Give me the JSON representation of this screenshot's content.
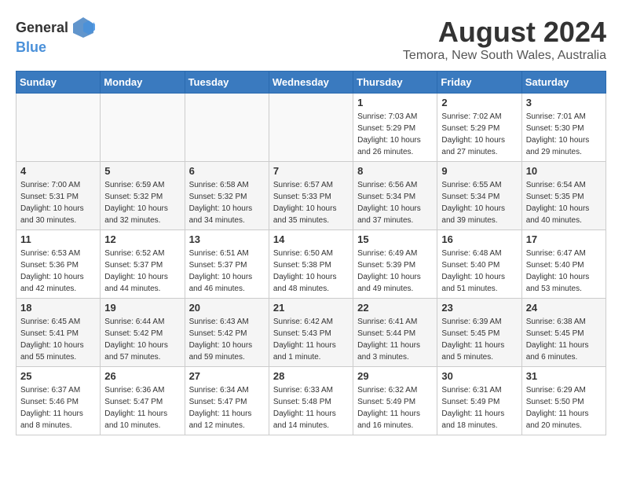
{
  "header": {
    "logo_general": "General",
    "logo_blue": "Blue",
    "title": "August 2024",
    "subtitle": "Temora, New South Wales, Australia"
  },
  "weekdays": [
    "Sunday",
    "Monday",
    "Tuesday",
    "Wednesday",
    "Thursday",
    "Friday",
    "Saturday"
  ],
  "weeks": [
    [
      {
        "num": "",
        "info": ""
      },
      {
        "num": "",
        "info": ""
      },
      {
        "num": "",
        "info": ""
      },
      {
        "num": "",
        "info": ""
      },
      {
        "num": "1",
        "info": "Sunrise: 7:03 AM\nSunset: 5:29 PM\nDaylight: 10 hours\nand 26 minutes."
      },
      {
        "num": "2",
        "info": "Sunrise: 7:02 AM\nSunset: 5:29 PM\nDaylight: 10 hours\nand 27 minutes."
      },
      {
        "num": "3",
        "info": "Sunrise: 7:01 AM\nSunset: 5:30 PM\nDaylight: 10 hours\nand 29 minutes."
      }
    ],
    [
      {
        "num": "4",
        "info": "Sunrise: 7:00 AM\nSunset: 5:31 PM\nDaylight: 10 hours\nand 30 minutes."
      },
      {
        "num": "5",
        "info": "Sunrise: 6:59 AM\nSunset: 5:32 PM\nDaylight: 10 hours\nand 32 minutes."
      },
      {
        "num": "6",
        "info": "Sunrise: 6:58 AM\nSunset: 5:32 PM\nDaylight: 10 hours\nand 34 minutes."
      },
      {
        "num": "7",
        "info": "Sunrise: 6:57 AM\nSunset: 5:33 PM\nDaylight: 10 hours\nand 35 minutes."
      },
      {
        "num": "8",
        "info": "Sunrise: 6:56 AM\nSunset: 5:34 PM\nDaylight: 10 hours\nand 37 minutes."
      },
      {
        "num": "9",
        "info": "Sunrise: 6:55 AM\nSunset: 5:34 PM\nDaylight: 10 hours\nand 39 minutes."
      },
      {
        "num": "10",
        "info": "Sunrise: 6:54 AM\nSunset: 5:35 PM\nDaylight: 10 hours\nand 40 minutes."
      }
    ],
    [
      {
        "num": "11",
        "info": "Sunrise: 6:53 AM\nSunset: 5:36 PM\nDaylight: 10 hours\nand 42 minutes."
      },
      {
        "num": "12",
        "info": "Sunrise: 6:52 AM\nSunset: 5:37 PM\nDaylight: 10 hours\nand 44 minutes."
      },
      {
        "num": "13",
        "info": "Sunrise: 6:51 AM\nSunset: 5:37 PM\nDaylight: 10 hours\nand 46 minutes."
      },
      {
        "num": "14",
        "info": "Sunrise: 6:50 AM\nSunset: 5:38 PM\nDaylight: 10 hours\nand 48 minutes."
      },
      {
        "num": "15",
        "info": "Sunrise: 6:49 AM\nSunset: 5:39 PM\nDaylight: 10 hours\nand 49 minutes."
      },
      {
        "num": "16",
        "info": "Sunrise: 6:48 AM\nSunset: 5:40 PM\nDaylight: 10 hours\nand 51 minutes."
      },
      {
        "num": "17",
        "info": "Sunrise: 6:47 AM\nSunset: 5:40 PM\nDaylight: 10 hours\nand 53 minutes."
      }
    ],
    [
      {
        "num": "18",
        "info": "Sunrise: 6:45 AM\nSunset: 5:41 PM\nDaylight: 10 hours\nand 55 minutes."
      },
      {
        "num": "19",
        "info": "Sunrise: 6:44 AM\nSunset: 5:42 PM\nDaylight: 10 hours\nand 57 minutes."
      },
      {
        "num": "20",
        "info": "Sunrise: 6:43 AM\nSunset: 5:42 PM\nDaylight: 10 hours\nand 59 minutes."
      },
      {
        "num": "21",
        "info": "Sunrise: 6:42 AM\nSunset: 5:43 PM\nDaylight: 11 hours\nand 1 minute."
      },
      {
        "num": "22",
        "info": "Sunrise: 6:41 AM\nSunset: 5:44 PM\nDaylight: 11 hours\nand 3 minutes."
      },
      {
        "num": "23",
        "info": "Sunrise: 6:39 AM\nSunset: 5:45 PM\nDaylight: 11 hours\nand 5 minutes."
      },
      {
        "num": "24",
        "info": "Sunrise: 6:38 AM\nSunset: 5:45 PM\nDaylight: 11 hours\nand 6 minutes."
      }
    ],
    [
      {
        "num": "25",
        "info": "Sunrise: 6:37 AM\nSunset: 5:46 PM\nDaylight: 11 hours\nand 8 minutes."
      },
      {
        "num": "26",
        "info": "Sunrise: 6:36 AM\nSunset: 5:47 PM\nDaylight: 11 hours\nand 10 minutes."
      },
      {
        "num": "27",
        "info": "Sunrise: 6:34 AM\nSunset: 5:47 PM\nDaylight: 11 hours\nand 12 minutes."
      },
      {
        "num": "28",
        "info": "Sunrise: 6:33 AM\nSunset: 5:48 PM\nDaylight: 11 hours\nand 14 minutes."
      },
      {
        "num": "29",
        "info": "Sunrise: 6:32 AM\nSunset: 5:49 PM\nDaylight: 11 hours\nand 16 minutes."
      },
      {
        "num": "30",
        "info": "Sunrise: 6:31 AM\nSunset: 5:49 PM\nDaylight: 11 hours\nand 18 minutes."
      },
      {
        "num": "31",
        "info": "Sunrise: 6:29 AM\nSunset: 5:50 PM\nDaylight: 11 hours\nand 20 minutes."
      }
    ]
  ]
}
